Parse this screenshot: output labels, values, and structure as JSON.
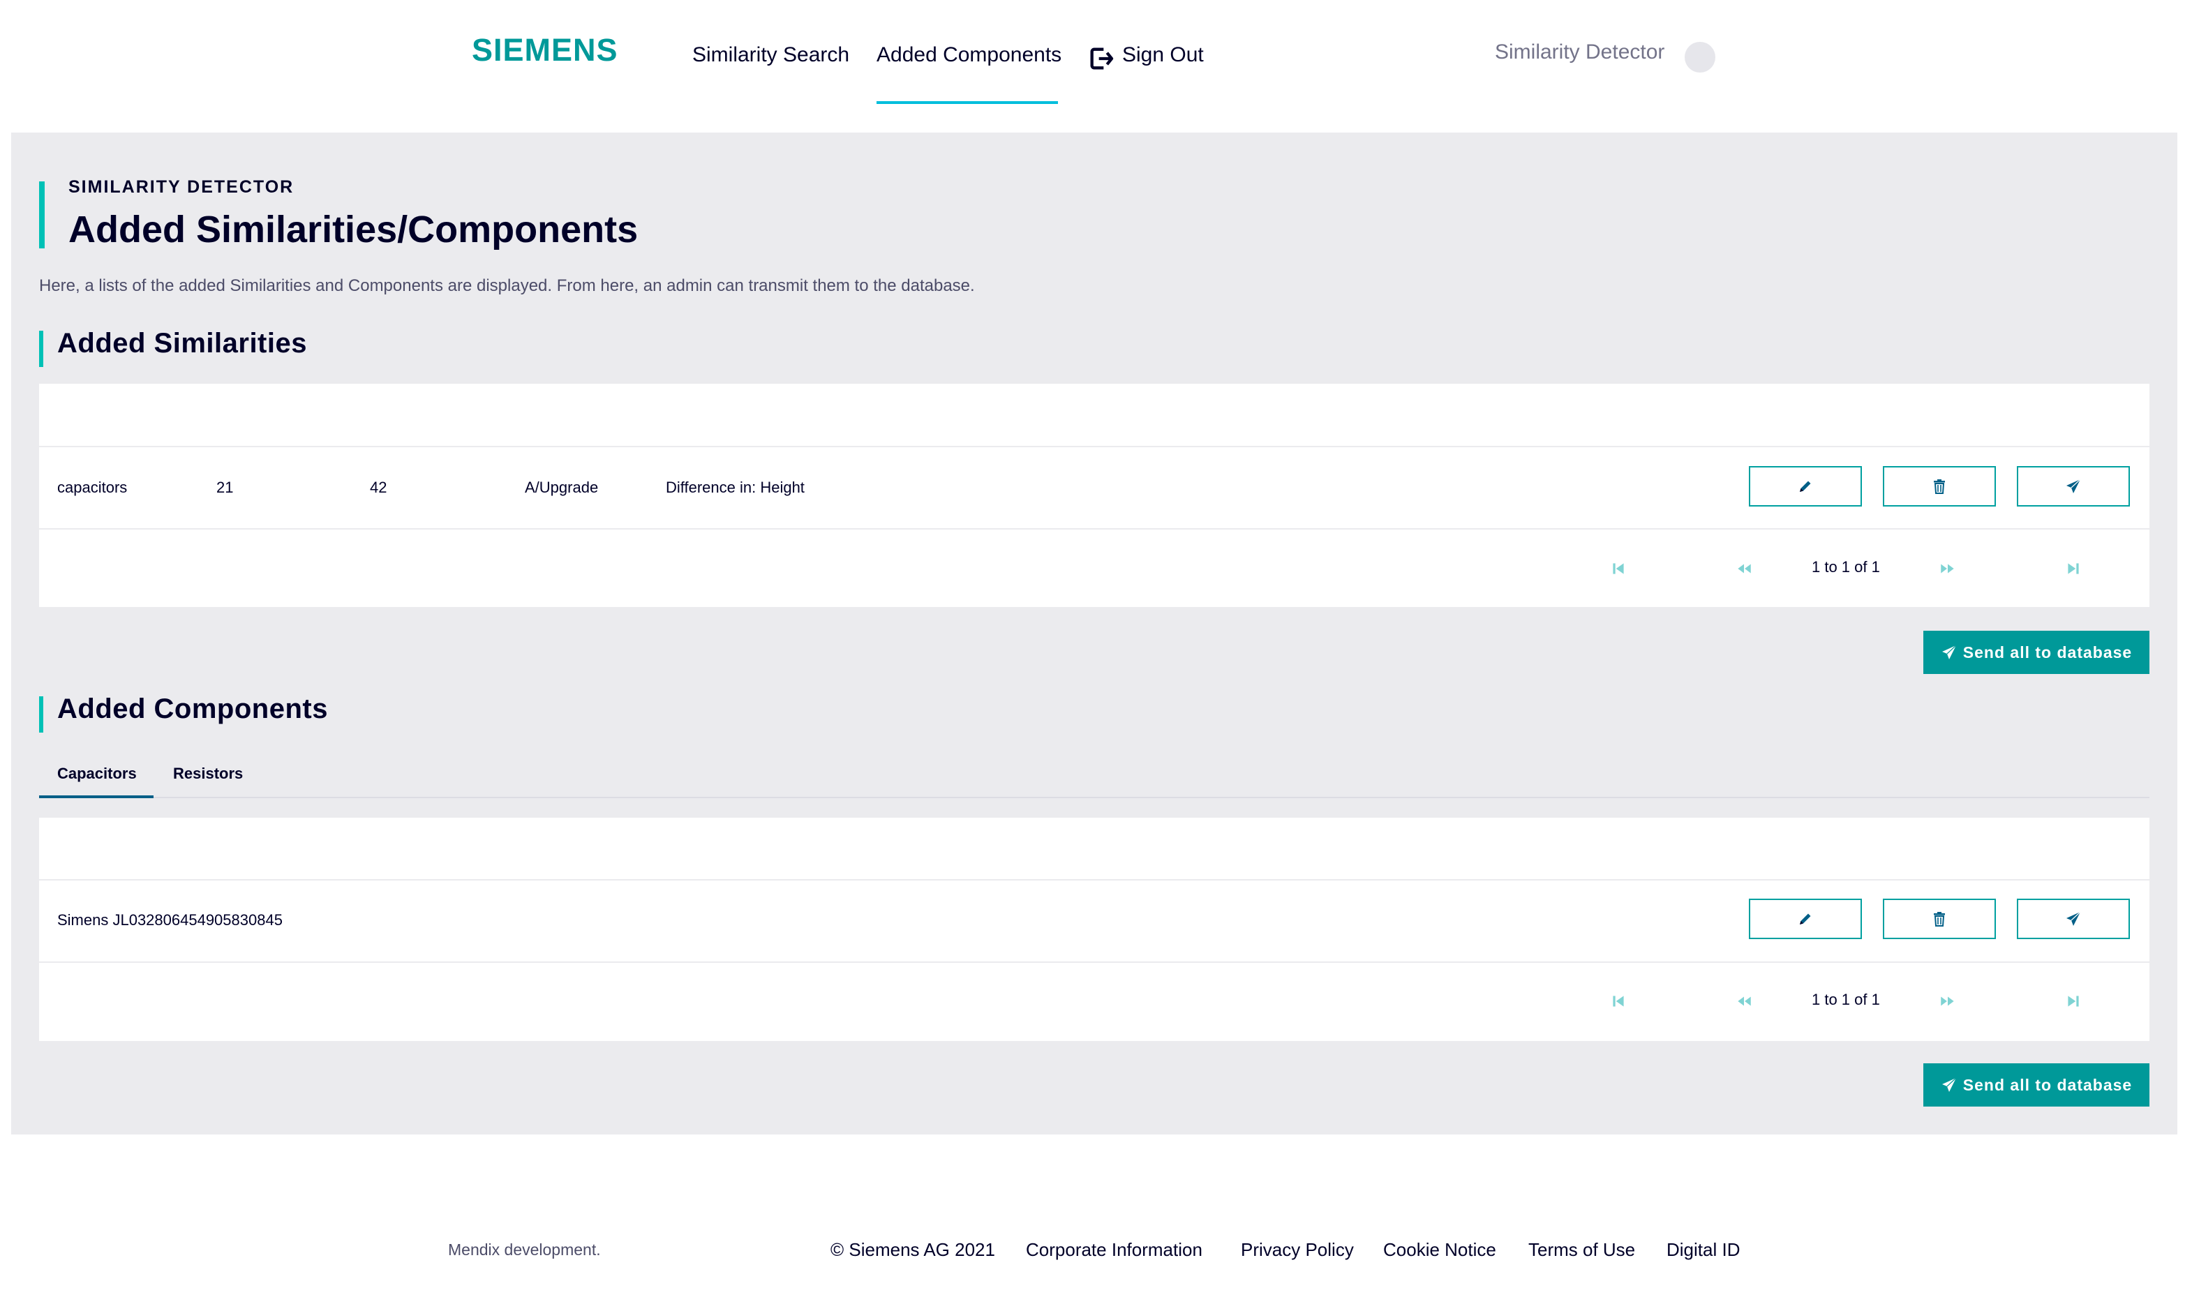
{
  "header": {
    "brand": "SIEMENS",
    "nav": [
      {
        "label": "Similarity Search"
      },
      {
        "label": "Added Components"
      },
      {
        "label": "Sign Out"
      }
    ],
    "app_name": "Similarity Detector"
  },
  "page": {
    "eyebrow": "SIMILARITY DETECTOR",
    "title": "Added Similarities/Components",
    "description": "Here, a lists of the added Similarities and Components are displayed. From here, an admin can transmit them to the database."
  },
  "similarities": {
    "title": "Added Similarities",
    "rows": [
      {
        "type": "capacitors",
        "a": "21",
        "b": "42",
        "category": "A/Upgrade",
        "difference": "Difference in: Height"
      }
    ],
    "pagination": "1 to 1 of 1",
    "send_all_label": "Send all to database"
  },
  "components": {
    "title": "Added Components",
    "tabs": [
      {
        "label": "Capacitors"
      },
      {
        "label": "Resistors"
      }
    ],
    "rows": [
      {
        "name": "Simens JL0328064549058308​45"
      }
    ],
    "pagination": "1 to 1 of 1",
    "send_all_label": "Send all to database"
  },
  "footer": {
    "note": "Mendix development.",
    "copyright": "© Siemens AG 2021",
    "links": [
      {
        "label": "Corporate Information"
      },
      {
        "label": "Privacy Policy"
      },
      {
        "label": "Cookie Notice"
      },
      {
        "label": "Terms of Use"
      },
      {
        "label": "Digital ID"
      }
    ]
  },
  "colors": {
    "brand": "#009999",
    "accent": "#00c1b6",
    "content_bg": "#ebebee",
    "text": "#000028"
  }
}
